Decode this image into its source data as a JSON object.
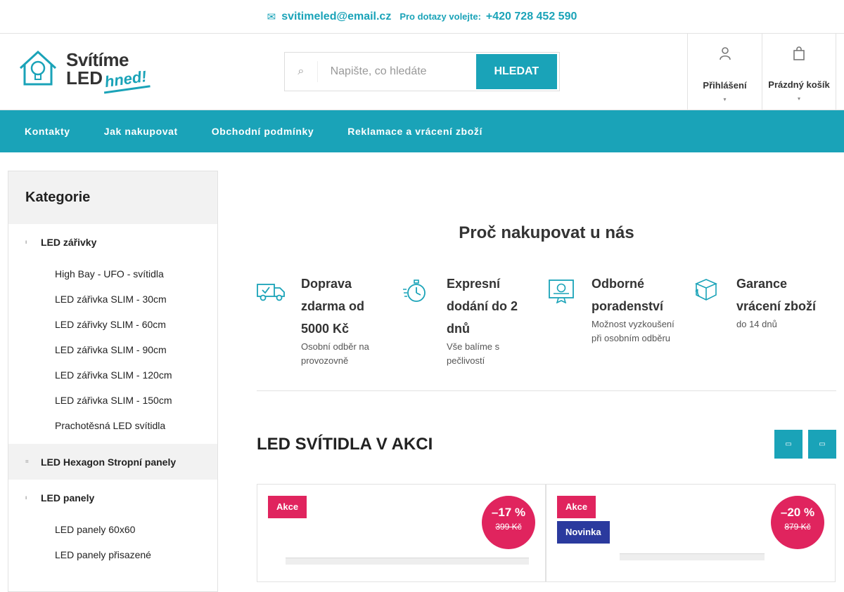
{
  "topbar": {
    "email": "svitimeled@email.cz",
    "ask_label": "Pro dotazy volejte:",
    "phone": "+420 728 452 590"
  },
  "logo": {
    "line1": "Svítíme",
    "line2": "LED",
    "tagline": "hned!"
  },
  "search": {
    "placeholder": "Napište, co hledáte",
    "button": "HLEDAT"
  },
  "header": {
    "login": "Přihlášení",
    "cart": "Prázdný košík"
  },
  "nav": [
    "Kontakty",
    "Jak nakupovat",
    "Obchodní podmínky",
    "Reklamace a vrácení zboží"
  ],
  "sidebar": {
    "title": "Kategorie",
    "categories": [
      {
        "label": "LED zářivky",
        "subs": [
          "High Bay - UFO - svítidla",
          "LED zářivka SLIM - 30cm",
          "LED zářivky SLIM - 60cm",
          "LED zářivka SLIM - 90cm",
          "LED zářivka SLIM - 120cm",
          "LED zářivka SLIM - 150cm",
          "Prachotěsná LED svítidla"
        ]
      },
      {
        "label": "LED Hexagon Stropní panely",
        "subs": []
      },
      {
        "label": "LED panely",
        "subs": [
          "LED panely 60x60",
          "LED panely přisazené"
        ]
      }
    ]
  },
  "why": {
    "title": "Proč nakupovat u nás",
    "items": [
      {
        "icon": "truck-icon",
        "title": "Doprava zdarma od 5000 Kč",
        "desc": "Osobní odběr na provozovně"
      },
      {
        "icon": "stopwatch-icon",
        "title": "Expresní dodání do 2 dnů",
        "desc": "Vše balíme s pečlivostí"
      },
      {
        "icon": "certificate-icon",
        "title": "Odborné poradenství",
        "desc": "Možnost vyzkoušení při osobním odběru"
      },
      {
        "icon": "box-return-icon",
        "title": "Garance vrácení zboží",
        "desc": "do 14 dnů"
      }
    ]
  },
  "sale": {
    "title": "LED SVÍTIDLA V AKCI",
    "products": [
      {
        "tags": [
          "Akce"
        ],
        "discount": "–17 %",
        "old_price": "399 Kč"
      },
      {
        "tags": [
          "Akce",
          "Novinka"
        ],
        "discount": "–20 %",
        "old_price": "879 Kč"
      }
    ]
  },
  "colors": {
    "accent": "#1aa3b8",
    "sale": "#e0245e",
    "new": "#2b3a9e"
  }
}
